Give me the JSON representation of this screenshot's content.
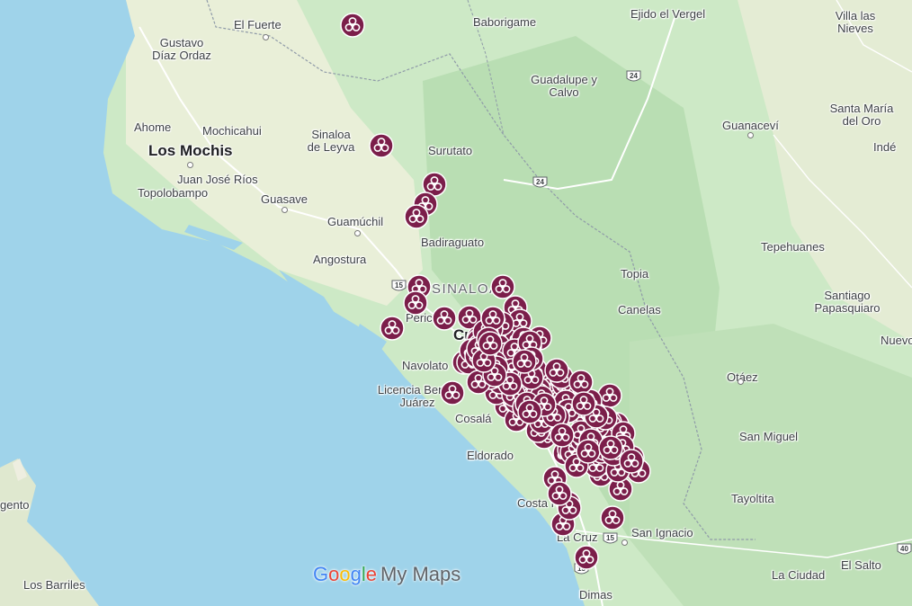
{
  "map": {
    "places": [
      {
        "name": "El Fuerte"
      },
      {
        "name": "Baborigame"
      },
      {
        "name": "Ejido el Vergel"
      },
      {
        "name": "Villa las Nieves"
      },
      {
        "name": "Gustavo Díaz Ordaz"
      },
      {
        "name": "Guadalupe y Calvo"
      },
      {
        "name": "Ahome"
      },
      {
        "name": "Mochicahui"
      },
      {
        "name": "Los Mochis",
        "style": "big"
      },
      {
        "name": "Sinaloa de Leyva"
      },
      {
        "name": "Surutato"
      },
      {
        "name": "Guanaceví"
      },
      {
        "name": "Santa María del Oro"
      },
      {
        "name": "Indé"
      },
      {
        "name": "Juan José Ríos"
      },
      {
        "name": "Topolobampo"
      },
      {
        "name": "Guasave"
      },
      {
        "name": "Guamúchil"
      },
      {
        "name": "Badiraguato"
      },
      {
        "name": "Tepehuanes"
      },
      {
        "name": "Angostura"
      },
      {
        "name": "Topia"
      },
      {
        "name": "SINALOA",
        "style": "state"
      },
      {
        "name": "Santiago Papasquiaro"
      },
      {
        "name": "Canelas"
      },
      {
        "name": "Perico"
      },
      {
        "name": "Culiacán"
      },
      {
        "name": "Nuevo"
      },
      {
        "name": "Navolato"
      },
      {
        "name": "Otáez"
      },
      {
        "name": "Licencia Benito Juárez"
      },
      {
        "name": "Cosalá"
      },
      {
        "name": "San Miguel"
      },
      {
        "name": "Eldorado"
      },
      {
        "name": "Tayoltita"
      },
      {
        "name": "Costa Rica"
      },
      {
        "name": "San Ignacio"
      },
      {
        "name": "La Cruz"
      },
      {
        "name": "El Salto"
      },
      {
        "name": "La Ciudad"
      },
      {
        "name": "Los Barriles"
      },
      {
        "name": "gento"
      },
      {
        "name": "Dimas"
      }
    ],
    "highway_shields": [
      "24",
      "24",
      "15",
      "15",
      "15",
      "40"
    ],
    "marker_icon": "biohazard-icon",
    "marker_color": "#7b1e4a",
    "marker_count": 160,
    "brand": {
      "google": "Google",
      "product": "My Maps"
    },
    "colors": {
      "water": "#9fd3ea",
      "land": "#cde9c6",
      "dry": "#eeeee0",
      "border": "#8f9aa8"
    }
  }
}
